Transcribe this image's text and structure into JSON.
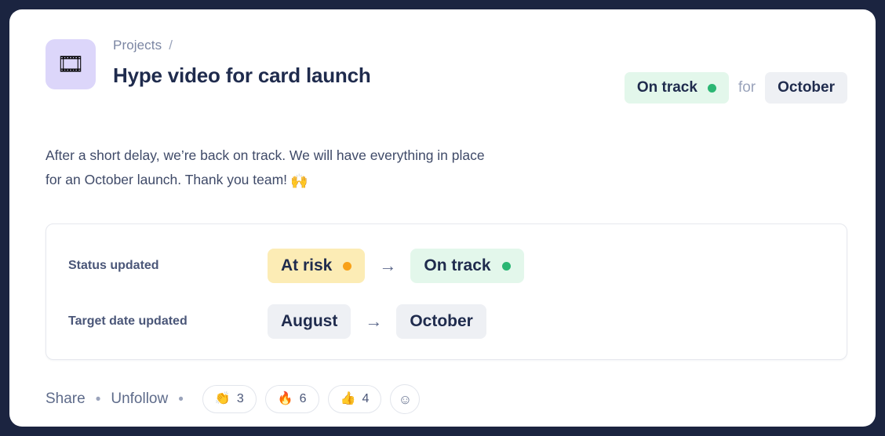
{
  "header": {
    "avatar_icon": "film-strip-icon",
    "avatar_glyph": "🎞",
    "breadcrumb_parent": "Projects",
    "breadcrumb_separator": "/",
    "title": "Hype video for card launch",
    "status_label": "On track",
    "status_dot_icon": "green-dot-icon",
    "for_label": "for",
    "target_date": "October"
  },
  "body": {
    "text": "After a short delay, we’re back on track. We will have everything in place for an October launch. Thank you team!",
    "emoji": "🙌",
    "emoji_name": "raising-hands-emoji"
  },
  "updates": {
    "rows": [
      {
        "label": "Status updated",
        "from": "At risk",
        "from_dot_icon": "orange-dot-icon",
        "to": "On track",
        "to_dot_icon": "green-dot-icon",
        "arrow": "→"
      },
      {
        "label": "Target date updated",
        "from": "August",
        "to": "October",
        "arrow": "→"
      }
    ]
  },
  "footer": {
    "share_label": "Share",
    "separator": "•",
    "unfollow_label": "Unfollow",
    "reactions": [
      {
        "emoji": "👏",
        "emoji_name": "clap-emoji",
        "count": "3"
      },
      {
        "emoji": "🔥",
        "emoji_name": "fire-emoji",
        "count": "6"
      },
      {
        "emoji": "👍",
        "emoji_name": "thumbs-up-emoji",
        "count": "4"
      }
    ],
    "add_reaction_glyph": "☺",
    "add_reaction_icon": "add-reaction-icon"
  },
  "colors": {
    "frame": "#1b2440",
    "status_green_bg": "#e3f7eb",
    "status_green_dot": "#2bb673",
    "status_yellow_bg": "#fcecb5",
    "status_orange_dot": "#f8a119",
    "neutral_pill_bg": "#eef0f4",
    "title_text": "#1f2b4d",
    "avatar_bg": "#dcd6fa"
  }
}
